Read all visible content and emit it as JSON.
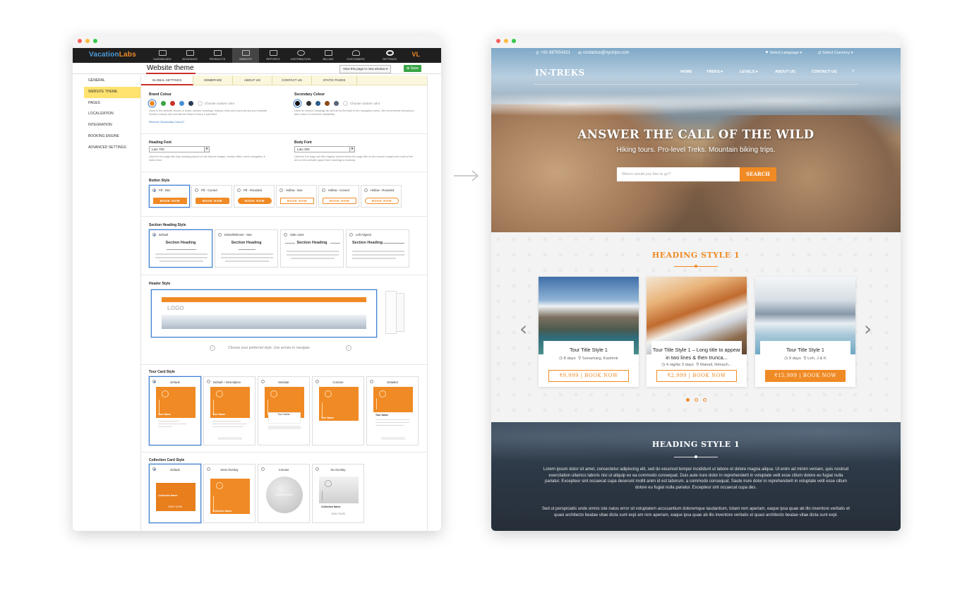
{
  "admin": {
    "brand": {
      "name_a": "Vacation",
      "name_b": "Labs"
    },
    "nav": [
      "DASHBOARD",
      "BOOKINGS",
      "PRODUCTS",
      "WEBSITE",
      "REPORTS",
      "DISTRIBUTION",
      "BILLING",
      "CUSTOMERS",
      "SETTINGS"
    ],
    "user_initials": "VL",
    "page_title": "Website theme",
    "view_button": "View this page in new window ▾",
    "save_button": "⊕ Save",
    "sidebar": [
      "GENERAL",
      "WEBSITE THEME",
      "PAGES",
      "LOCALIZATION",
      "INTEGRATION",
      "BOOKING ENGINE",
      "ADVANCED SETTINGS"
    ],
    "tabs": [
      "GLOBAL SETTINGS",
      "HOMEPAGE",
      "ABOUT US",
      "CONTACT US",
      "STATIC PAGES"
    ],
    "brand_colour": {
      "label": "Brand Colour",
      "custom": "Choose custom color",
      "help": "Used in the website header & footer, section headings, buttons, links and icons across your website. Section colours will override the Brand Colour if specified.",
      "remove_link": "Remove Secondary Colour?",
      "swatches": [
        "#f08a24",
        "#3aa547",
        "#c9302c",
        "#4a8fd4",
        "#2b3d55"
      ]
    },
    "secondary_colour": {
      "label": "Secondary Colour",
      "custom": "Choose custom color",
      "help": "Used for section headings as well as for the links in the navigation menu. We recommend choosing a dark colour to enhance readability.",
      "swatches": [
        "#111111",
        "#333333",
        "#2a5c8c",
        "#8a4a16",
        "#5a6678"
      ]
    },
    "heading_font": {
      "label": "Heading Font",
      "value": "Lato 700",
      "help": "Used for the page title (big heading placed on the banner image), section titles, menu navigation & button text."
    },
    "body_font": {
      "label": "Body Font",
      "value": "Lato 300",
      "help": "Used for the page sub title (tagline placed below the page title on the banner image) and most of the text on the website (apart from headings & buttons)."
    },
    "button_style": {
      "label": "Button Style",
      "options": [
        "Fill - Box",
        "Fill - Curved",
        "Fill - Rounded",
        "Hollow - Box",
        "Hollow - Curved",
        "Hollow - Rounded"
      ],
      "sample": "BOOK NOW"
    },
    "section_heading": {
      "label": "Section Heading Style",
      "options": [
        "Default",
        "Embellishment - Star",
        "Side Lines",
        "Left Aligned"
      ],
      "sample": "Section Heading"
    },
    "header_style": {
      "label": "Header Style",
      "logo": "LOGO",
      "hint": "Choose your preferred style. Use arrows to navigate."
    },
    "tour_card": {
      "label": "Tour Card Style",
      "options": [
        "Default",
        "Default + Description",
        "Modular",
        "Concise",
        "Detailed"
      ],
      "sample_name": "Tour Name"
    },
    "collection_card": {
      "label": "Collection Card Style",
      "options": [
        "Default",
        "Semi Overlay",
        "Circular",
        "No Overlay"
      ],
      "sample_name": "Collection Name",
      "view_tours": "VIEW TOURS"
    }
  },
  "site": {
    "phone": "+91-987654321",
    "email": "contactus@nyctrips.com",
    "language": "Select Language",
    "currency": "Select Currency",
    "logo": "IN-TREKS",
    "menu": [
      "HOME",
      "TREKS ▾",
      "LEVELS ▾",
      "ABOUT US",
      "CONTACT US"
    ],
    "hero_title": "ANSWER THE CALL OF THE WILD",
    "hero_subtitle": "Hiking tours. Pro-level Treks. Mountain biking trips.",
    "search_placeholder": "Where would you like to go?",
    "search_button": "SEARCH",
    "heading_style": "HEADING STYLE 1",
    "tours": [
      {
        "name": "Tour Title Style 1",
        "days": "8 days",
        "place": "Sonamarg, Kashmir",
        "price": "₹9,999",
        "cta": "BOOK NOW"
      },
      {
        "name": "Tour Title Style 1 – Long title  to appear in two lines & then trunca...",
        "days": "4 nights 3 days",
        "place": "Manali, Himach...",
        "price": "₹2,999",
        "cta": "BOOK NOW"
      },
      {
        "name": "Tour Title Style 1",
        "days": "9 days",
        "place": "Leh, J & K",
        "price": "₹15,999",
        "cta": "BOOK NOW"
      }
    ],
    "para1": "Lorem ipsum dolor sit amet, consectetur adipiscing elit, sed do eiusmod tempor incididunt ut labore et dolore magna aliqua. Ut enim ad minim veniam, quis nostrud exercitation ullamco laboris nisi ut aliquip ex ea commodo consequat. Duis aute irure dolor in reprehenderit in voluptate velit esse cillum dolore eu fugiat nulla pariatur. Excepteur sint occaecat cupa deserunt mollit anim id est laborum. a commodo consequat. Saute irure dolor in reprehenderit in voluptate velit esse cillum dolore eu fugiat nulla pariatur. Excepteur sint occaecat cupa des.",
    "para2": "Sed ut perspiciatis unde omnis iste natus error sit voluptatem accusantium doloremque laudantium, totam rem aperiam, eaque ipsa quae ab illo inventore veritatis et quasi architecto beatae vitae dicta sunt expl am rem aperiam, eaque ipsa quae ab illo inventore veritatis et quasi architecto beatae vitae dicta sunt expl."
  },
  "colors": {
    "accent": "#f08a24",
    "admin_bar": "#1f1f1f",
    "active_side": "#ffe36e",
    "save_green": "#3aa547"
  }
}
